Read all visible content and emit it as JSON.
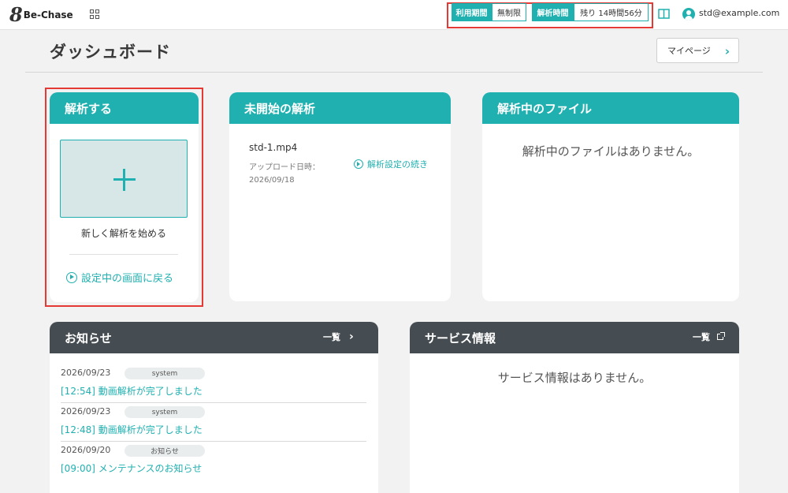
{
  "header": {
    "logo_mark": "8",
    "logo_text": "Be-Chase",
    "usage_period_label": "利用期間",
    "usage_period_value": "無制限",
    "analysis_time_label": "解析時間",
    "analysis_time_value": "残り 14時間56分",
    "user_email": "std@example.com"
  },
  "page": {
    "title": "ダッシュボード",
    "mypage_label": "マイページ"
  },
  "analyze_card": {
    "title": "解析する",
    "start_label": "新しく解析を始める",
    "back_label": "設定中の画面に戻る"
  },
  "pending_card": {
    "title": "未開始の解析",
    "file_name": "std-1.mp4",
    "upload_label": "アップロード日時：",
    "upload_date": "2026/09/18",
    "continue_label": "解析設定の続き"
  },
  "inprogress_card": {
    "title": "解析中のファイル",
    "empty_message": "解析中のファイルはありません。"
  },
  "news_card": {
    "title": "お知らせ",
    "list_link": "一覧",
    "items": [
      {
        "date": "2026/09/23",
        "badge": "system",
        "title": "[12:54] 動画解析が完了しました"
      },
      {
        "date": "2026/09/23",
        "badge": "system",
        "title": "[12:48] 動画解析が完了しました"
      },
      {
        "date": "2026/09/20",
        "badge": "お知らせ",
        "title": "[09:00] メンテナンスのお知らせ"
      }
    ]
  },
  "service_card": {
    "title": "サービス情報",
    "list_link": "一覧",
    "empty_message": "サービス情報はありません。"
  },
  "colors": {
    "accent": "#21b0b0",
    "dark_header": "#464d52",
    "highlight": "#e53935",
    "background": "#f2f2f2"
  }
}
